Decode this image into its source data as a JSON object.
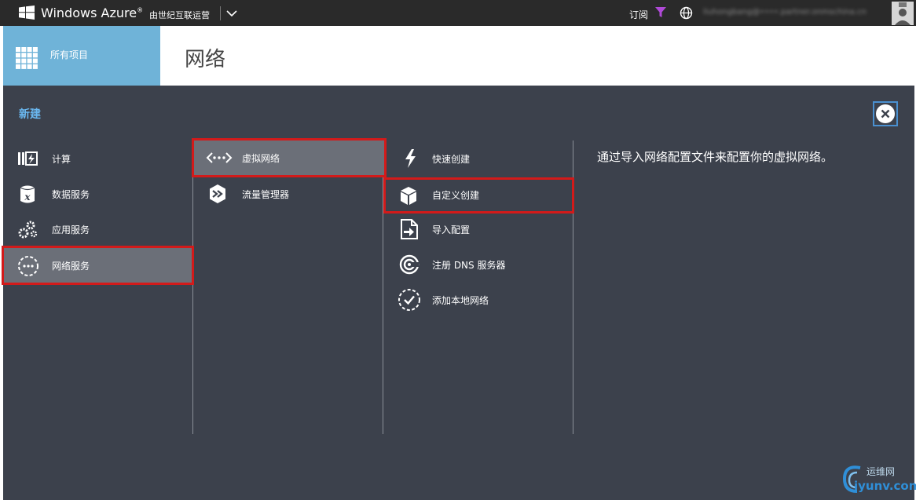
{
  "topbar": {
    "brand": "Windows Azure",
    "brand_mark": "®",
    "operator": "由世纪互联运营",
    "subscription_label": "订阅",
    "account": "liuhongbang@••••.partner.onmschina.cn"
  },
  "header": {
    "all_items_label": "所有项目",
    "page_title": "网络"
  },
  "drawer": {
    "title": "新建",
    "categories": [
      {
        "label": "计算",
        "icon": "compute-icon"
      },
      {
        "label": "数据服务",
        "icon": "data-services-icon"
      },
      {
        "label": "应用服务",
        "icon": "app-services-icon"
      },
      {
        "label": "网络服务",
        "icon": "network-services-icon",
        "selected": true
      }
    ],
    "services": [
      {
        "label": "虚拟网络",
        "icon": "virtual-network-icon",
        "selected": true
      },
      {
        "label": "流量管理器",
        "icon": "traffic-manager-icon"
      }
    ],
    "actions": [
      {
        "label": "快速创建",
        "icon": "lightning-icon"
      },
      {
        "label": "自定义创建",
        "icon": "box-icon"
      },
      {
        "label": "导入配置",
        "icon": "import-file-icon"
      },
      {
        "label": "注册 DNS 服务器",
        "icon": "dns-icon"
      },
      {
        "label": "添加本地网络",
        "icon": "local-network-icon"
      }
    ],
    "description": "通过导入网络配置文件来配置你的虚拟网络。"
  },
  "watermark": {
    "top": "运维网",
    "bottom": "iyunv.com"
  },
  "colors": {
    "topbar": "#2a2a2a",
    "accent_blue": "#6fb3d8",
    "drawer_bg": "#3c414c",
    "selected_bg": "#6b6f78",
    "highlight_red": "#d31a1a",
    "filter_purple": "#b04ad8"
  }
}
